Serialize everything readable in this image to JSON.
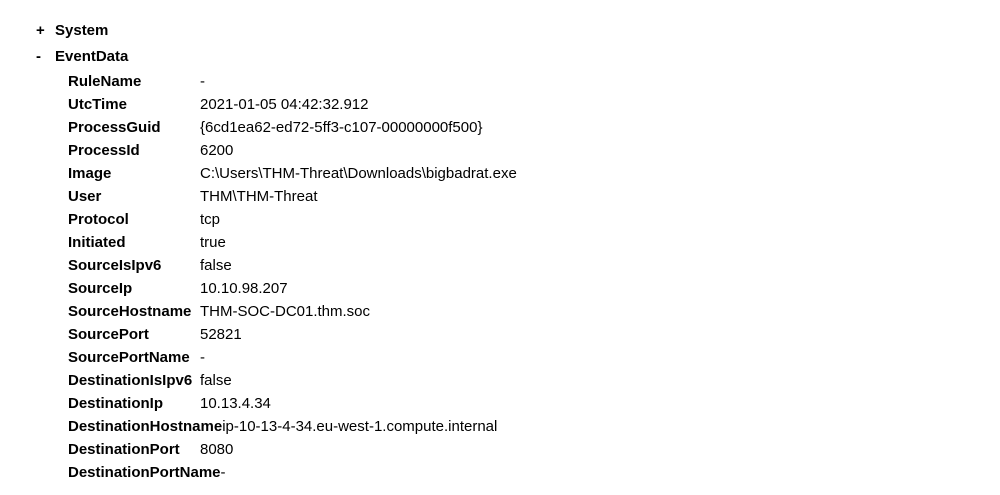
{
  "tree": {
    "system": {
      "toggle": "+",
      "label": "System"
    },
    "eventdata": {
      "toggle": "-",
      "label": "EventData",
      "fields": [
        {
          "key": "RuleName",
          "value": "-"
        },
        {
          "key": "UtcTime",
          "value": "2021-01-05 04:42:32.912"
        },
        {
          "key": "ProcessGuid",
          "value": "{6cd1ea62-ed72-5ff3-c107-00000000f500}"
        },
        {
          "key": "ProcessId",
          "value": "6200"
        },
        {
          "key": "Image",
          "value": "C:\\Users\\THM-Threat\\Downloads\\bigbadrat.exe"
        },
        {
          "key": "User",
          "value": "THM\\THM-Threat"
        },
        {
          "key": "Protocol",
          "value": "tcp"
        },
        {
          "key": "Initiated",
          "value": "true"
        },
        {
          "key": "SourceIsIpv6",
          "value": "false"
        },
        {
          "key": "SourceIp",
          "value": "10.10.98.207"
        },
        {
          "key": "SourceHostname",
          "value": "THM-SOC-DC01.thm.soc"
        },
        {
          "key": "SourcePort",
          "value": "52821"
        },
        {
          "key": "SourcePortName",
          "value": "-"
        },
        {
          "key": "DestinationIsIpv6",
          "value": "false"
        },
        {
          "key": "DestinationIp",
          "value": "10.13.4.34"
        },
        {
          "key": "DestinationHostname",
          "value": "ip-10-13-4-34.eu-west-1.compute.internal"
        },
        {
          "key": "DestinationPort",
          "value": "8080"
        },
        {
          "key": "DestinationPortName",
          "value": "-"
        }
      ]
    }
  }
}
